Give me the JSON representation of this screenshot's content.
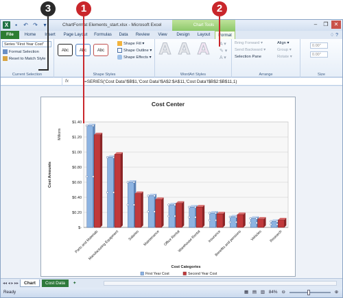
{
  "callouts": [
    "3",
    "1",
    "2"
  ],
  "window": {
    "title": "ChartFormat Elements_start.xlsx - Microsoft Excel",
    "chart_tools_label": "Chart Tools"
  },
  "tabs": [
    "File",
    "Home",
    "Insert",
    "Page Layout",
    "Formulas",
    "Data",
    "Review",
    "View",
    "Design",
    "Layout",
    "Format"
  ],
  "ribbon": {
    "current_selection": {
      "selected_element": "Series \"First Year Cost\"",
      "format_selection": "Format Selection",
      "reset_to_match_style": "Reset to Match Style",
      "label": "Current Selection"
    },
    "shape_styles": {
      "presets": [
        "Abc",
        "Abc",
        "Abc"
      ],
      "shape_fill": "Shape Fill",
      "shape_outline": "Shape Outline",
      "shape_effects": "Shape Effects",
      "label": "Shape Styles"
    },
    "wordart_styles": {
      "letters": [
        "A",
        "A",
        "A"
      ],
      "label": "WordArt Styles"
    },
    "arrange": {
      "bring_forward": "Bring Forward",
      "send_backward": "Send Backward",
      "selection_pane": "Selection Pane",
      "align": "Align",
      "group": "Group",
      "rotate": "Rotate",
      "label": "Arrange"
    },
    "size": {
      "height": "0.00\"",
      "width": "0.00\"",
      "label": "Size"
    }
  },
  "formula_bar": {
    "fx": "fx",
    "formula": "=SERIES('Cost Data'!$B$1,'Cost Data'!$A$2:$A$11,'Cost Data'!$B$2:$B$11,1)"
  },
  "chart_data": {
    "type": "bar",
    "title": "Cost Center",
    "xlabel": "Cost Categories",
    "ylabel": "Cost Amounts",
    "unit_label": "Millions",
    "categories": [
      "Parts and Materials",
      "Manufacturing Equipment",
      "Salaries",
      "Maintenance",
      "Office Rental",
      "Warehouse Rental",
      "Insurance",
      "Benefits and pensions",
      "Vehicles",
      "Research"
    ],
    "series": [
      {
        "name": "First Year Cost",
        "color": "#8db4e2",
        "values": [
          1.35,
          0.93,
          0.6,
          0.42,
          0.3,
          0.27,
          0.19,
          0.14,
          0.12,
          0.08
        ]
      },
      {
        "name": "Second Year Cost",
        "color": "#c0393b",
        "values": [
          1.23,
          0.97,
          0.45,
          0.37,
          0.32,
          0.27,
          0.18,
          0.17,
          0.11,
          0.1
        ]
      }
    ],
    "yticks": [
      "$-",
      "$0.20",
      "$0.40",
      "$0.60",
      "$0.80",
      "$1.00",
      "$1.20",
      "$1.40"
    ],
    "ylim": [
      0,
      1.4
    ],
    "grid": true,
    "legend": "bottom"
  },
  "sheet_tabs": [
    "Chart",
    "Cost Data"
  ],
  "status": {
    "ready": "Ready",
    "zoom": "84%"
  }
}
